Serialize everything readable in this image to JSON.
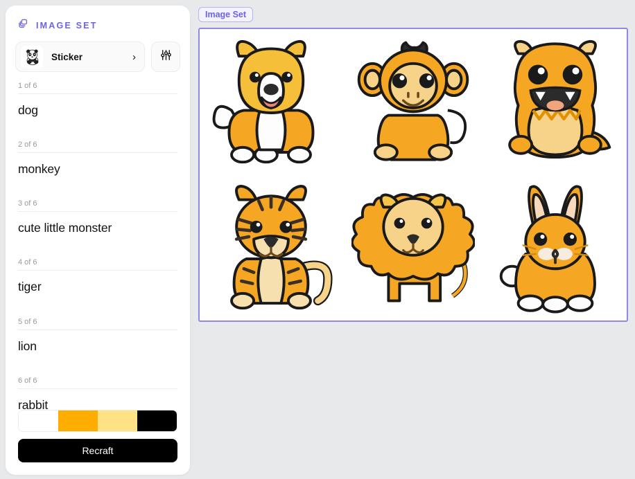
{
  "sidebar": {
    "header": {
      "icon": "layers-stack-icon",
      "title": "IMAGE SET"
    },
    "model_selector": {
      "avatar_icon": "panda-avatar",
      "label": "Sticker",
      "chevron": "›"
    },
    "settings_button": {
      "icon": "sliders-icon"
    },
    "prompts": [
      {
        "counter": "1 of 6",
        "text": "dog"
      },
      {
        "counter": "2 of 6",
        "text": "monkey"
      },
      {
        "counter": "3 of 6",
        "text": "cute little monster"
      },
      {
        "counter": "4 of 6",
        "text": "tiger"
      },
      {
        "counter": "5 of 6",
        "text": "lion"
      },
      {
        "counter": "6 of 6",
        "text": "rabbit"
      }
    ],
    "palette": {
      "name": "color-palette",
      "swatches": [
        "#ffffff",
        "#ffae00",
        "#ffe285",
        "#000000"
      ]
    },
    "recraft_button": {
      "label": "Recraft"
    }
  },
  "main": {
    "badge": {
      "label": "Image Set"
    },
    "canvas": {
      "border_color": "#8f86ee",
      "images": [
        {
          "name": "dog-sticker",
          "alt": "dog"
        },
        {
          "name": "monkey-sticker",
          "alt": "monkey"
        },
        {
          "name": "monster-sticker",
          "alt": "cute little monster"
        },
        {
          "name": "tiger-sticker",
          "alt": "tiger"
        },
        {
          "name": "lion-sticker",
          "alt": "lion"
        },
        {
          "name": "rabbit-sticker",
          "alt": "rabbit"
        }
      ]
    }
  },
  "theme": {
    "accent": "#6c63e8",
    "background": "#e8e9eb",
    "panel": "#ffffff",
    "text": "#111111",
    "muted": "#9a9a9e"
  }
}
